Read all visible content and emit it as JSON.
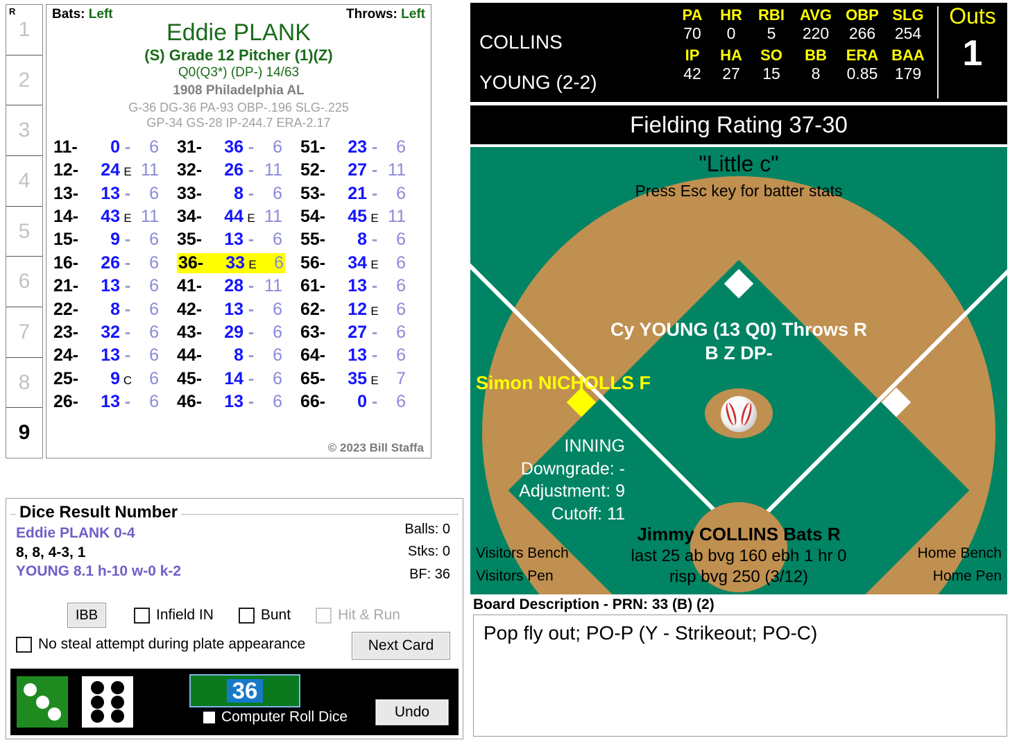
{
  "card": {
    "innings": [
      "1",
      "2",
      "3",
      "4",
      "5",
      "6",
      "7",
      "8",
      "9"
    ],
    "inning_header": "R",
    "current_inning": "9",
    "bats_label": "Bats:",
    "bats_value": "Left",
    "throws_label": "Throws:",
    "throws_value": "Left",
    "player_name": "Eddie PLANK",
    "grade_line": "(S) Grade 12 Pitcher (1)(Z)",
    "q_line": "Q0(Q3*)  (DP-) 14/63",
    "team_line": "1908 Philadelphia AL",
    "stat_line_1": "G-36 DG-36 PA-93 OBP-.196 SLG-.225",
    "stat_line_2": "GP-34 GS-28 IP-244.7 ERA-2.17",
    "copyright": "© 2023 Bill Staffa",
    "rows": [
      [
        {
          "k": "11-",
          "v": "0",
          "m": "-",
          "r": "6",
          "hl": false
        },
        {
          "k": "31-",
          "v": "36",
          "m": "-",
          "r": "6",
          "hl": false
        },
        {
          "k": "51-",
          "v": "23",
          "m": "-",
          "r": "6",
          "hl": false
        }
      ],
      [
        {
          "k": "12-",
          "v": "24",
          "m": "E",
          "r": "11",
          "hl": false
        },
        {
          "k": "32-",
          "v": "26",
          "m": "-",
          "r": "11",
          "hl": false
        },
        {
          "k": "52-",
          "v": "27",
          "m": "-",
          "r": "11",
          "hl": false
        }
      ],
      [
        {
          "k": "13-",
          "v": "13",
          "m": "-",
          "r": "6",
          "hl": false
        },
        {
          "k": "33-",
          "v": "8",
          "m": "-",
          "r": "6",
          "hl": false
        },
        {
          "k": "53-",
          "v": "21",
          "m": "-",
          "r": "6",
          "hl": false
        }
      ],
      [
        {
          "k": "14-",
          "v": "43",
          "m": "E",
          "r": "11",
          "hl": false
        },
        {
          "k": "34-",
          "v": "44",
          "m": "E",
          "r": "11",
          "hl": false
        },
        {
          "k": "54-",
          "v": "45",
          "m": "E",
          "r": "11",
          "hl": false
        }
      ],
      [
        {
          "k": "15-",
          "v": "9",
          "m": "-",
          "r": "6",
          "hl": false
        },
        {
          "k": "35-",
          "v": "13",
          "m": "-",
          "r": "6",
          "hl": false
        },
        {
          "k": "55-",
          "v": "8",
          "m": "-",
          "r": "6",
          "hl": false
        }
      ],
      [
        {
          "k": "16-",
          "v": "26",
          "m": "-",
          "r": "6",
          "hl": false
        },
        {
          "k": "36-",
          "v": "33",
          "m": "E",
          "r": "6",
          "hl": true
        },
        {
          "k": "56-",
          "v": "34",
          "m": "E",
          "r": "6",
          "hl": false
        }
      ],
      [
        {
          "k": "21-",
          "v": "13",
          "m": "-",
          "r": "6",
          "hl": false
        },
        {
          "k": "41-",
          "v": "28",
          "m": "-",
          "r": "11",
          "hl": false
        },
        {
          "k": "61-",
          "v": "13",
          "m": "-",
          "r": "6",
          "hl": false
        }
      ],
      [
        {
          "k": "22-",
          "v": "8",
          "m": "-",
          "r": "6",
          "hl": false
        },
        {
          "k": "42-",
          "v": "13",
          "m": "-",
          "r": "6",
          "hl": false
        },
        {
          "k": "62-",
          "v": "12",
          "m": "E",
          "r": "6",
          "hl": false
        }
      ],
      [
        {
          "k": "23-",
          "v": "32",
          "m": "-",
          "r": "6",
          "hl": false
        },
        {
          "k": "43-",
          "v": "29",
          "m": "-",
          "r": "6",
          "hl": false
        },
        {
          "k": "63-",
          "v": "27",
          "m": "-",
          "r": "6",
          "hl": false
        }
      ],
      [
        {
          "k": "24-",
          "v": "13",
          "m": "-",
          "r": "6",
          "hl": false
        },
        {
          "k": "44-",
          "v": "8",
          "m": "-",
          "r": "6",
          "hl": false
        },
        {
          "k": "64-",
          "v": "13",
          "m": "-",
          "r": "6",
          "hl": false
        }
      ],
      [
        {
          "k": "25-",
          "v": "9",
          "m": "C",
          "r": "6",
          "hl": false
        },
        {
          "k": "45-",
          "v": "14",
          "m": "-",
          "r": "6",
          "hl": false
        },
        {
          "k": "65-",
          "v": "35",
          "m": "E",
          "r": "7",
          "hl": false
        }
      ],
      [
        {
          "k": "26-",
          "v": "13",
          "m": "-",
          "r": "6",
          "hl": false
        },
        {
          "k": "46-",
          "v": "13",
          "m": "-",
          "r": "6",
          "hl": false
        },
        {
          "k": "66-",
          "v": "0",
          "m": "-",
          "r": "6",
          "hl": false
        }
      ]
    ]
  },
  "dice_panel": {
    "title": "Dice Result Number",
    "pitcher_line": "Eddie PLANK  0-4",
    "counts_line": "8, 8, 4-3, 1",
    "opp_line": "YOUNG  8.1  h-10  w-0  k-2",
    "balls": "Balls: 0",
    "strikes": "Stks: 0",
    "bf": "BF: 36",
    "ibb_label": "IBB",
    "infield_in_label": "Infield IN",
    "bunt_label": "Bunt",
    "hit_run_label": "Hit & Run",
    "no_steal_label": "No steal attempt during plate appearance",
    "next_card_label": "Next Card",
    "roll_value": "36",
    "computer_roll_label": "Computer Roll Dice",
    "undo_label": "Undo",
    "green_die_value": 3,
    "white_die_value": 6,
    "colors": {
      "green_die": "#1f8a1f",
      "roll_bg": "#0b7a1f",
      "roll_num_bg": "#1779c8"
    }
  },
  "scoreboard": {
    "batter_name": "COLLINS",
    "pitcher_name": "YOUNG (2-2)",
    "batter_headers": [
      "PA",
      "HR",
      "RBI",
      "AVG",
      "OBP",
      "SLG"
    ],
    "batter_values": [
      "70",
      "0",
      "5",
      "220",
      "266",
      "254"
    ],
    "pitcher_headers": [
      "IP",
      "HA",
      "SO",
      "BB",
      "ERA",
      "BAA"
    ],
    "pitcher_values": [
      "42",
      "27",
      "15",
      "8",
      "0.85",
      "179"
    ],
    "outs_label": "Outs",
    "outs_value": "1",
    "fielding_rating": "Fielding Rating 37-30"
  },
  "field": {
    "title": "\"Little c\"",
    "subtitle": "Press Esc key for batter stats",
    "pitcher_line_1": "Cy YOUNG (13 Q0) Throws R",
    "pitcher_line_2": "B Z DP-",
    "runner": "Simon NICHOLLS F",
    "inning_label": "INNING",
    "downgrade": "Downgrade: -",
    "adjustment": "Adjustment: 9",
    "cutoff": "Cutoff: 11",
    "batter_line_1": "Jimmy COLLINS Bats R",
    "batter_line_2": "last 25 ab bvg 160 ebh 1 hr 0",
    "batter_line_3": "risp bvg 250 (3/12)",
    "visitors_bench": "Visitors Bench",
    "visitors_pen": "Visitors Pen",
    "home_bench": "Home Bench",
    "home_pen": "Home Pen",
    "colors": {
      "grass": "#008463",
      "dirt": "#c09050",
      "runner_base": "#ffff00"
    }
  },
  "board": {
    "title": "Board Description - PRN: 33 (B) (2)",
    "text": "Pop fly out; PO-P (Y - Strikeout; PO-C)"
  }
}
